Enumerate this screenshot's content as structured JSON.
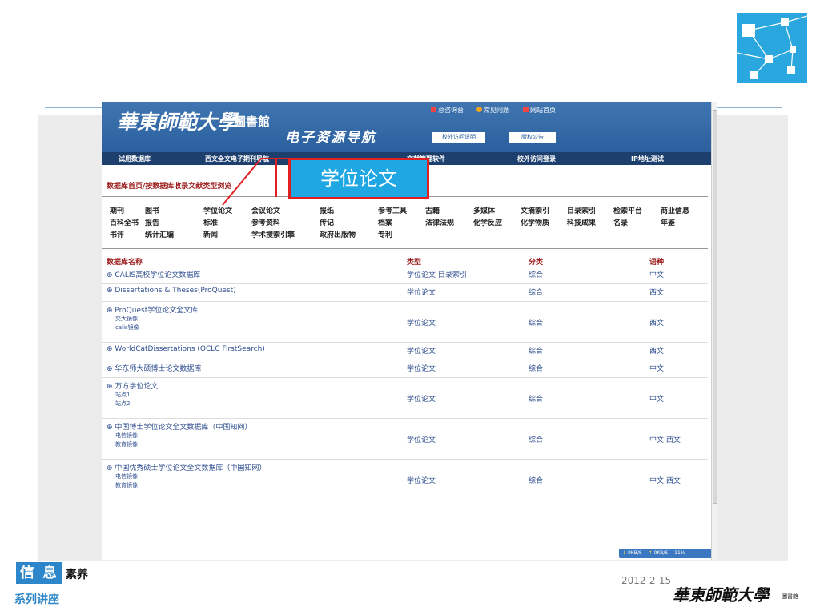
{
  "slide": {
    "callout": "学位论文",
    "badge": "信 息",
    "badge_suffix": "素养",
    "series": "系列讲座",
    "date": "2012-2-15",
    "footer_logo": "華東師範大學",
    "footer_logo_small": "圖書館",
    "accent": "#2c86c9"
  },
  "site": {
    "logo": "華東師範大學",
    "logo_small": "圖書館",
    "slogan": "电子资源导航",
    "top_links": [
      "总咨询台",
      "常见问题",
      "网站首页"
    ],
    "top_buttons": [
      "校外访问说明",
      "版权公告"
    ],
    "nav": [
      "试用数据库",
      "西文全文电子期刊导航",
      "文献管理软件",
      "校外访问登录",
      "IP地址测试"
    ],
    "breadcrumb": "数据库首页/按数据库收录文献类型浏览",
    "categories": [
      [
        "期刊",
        "百科全书",
        "书评"
      ],
      [
        "图书",
        "报告",
        "统计汇编"
      ],
      [
        "学位论文",
        "标准",
        "新闻"
      ],
      [
        "会议论文",
        "参考资料",
        "学术搜索引擎"
      ],
      [
        "报纸",
        "传记",
        "政府出版物"
      ],
      [
        "参考工具",
        "档案",
        "专利"
      ],
      [
        "古籍",
        "法律法规"
      ],
      [
        "多媒体",
        "化学反应"
      ],
      [
        "文摘索引",
        "化学物质"
      ],
      [
        "目录索引",
        "科技成果"
      ],
      [
        "检索平台",
        "名录"
      ],
      [
        "商业信息",
        "年鉴"
      ]
    ],
    "headers": {
      "name": "数据库名称",
      "type": "类型",
      "class": "分类",
      "lang": "语种"
    },
    "rows": [
      {
        "name": "CALIS高校学位论文数据库",
        "subs": [],
        "type": "学位论文 目录索引",
        "class": "综合",
        "lang": "中文"
      },
      {
        "name": "Dissertations & Theses(ProQuest)",
        "subs": [],
        "type": "学位论文",
        "class": "综合",
        "lang": "西文"
      },
      {
        "name": "ProQuest学位论文全文库",
        "subs": [
          "交大镜像",
          "calis镜像"
        ],
        "type": "学位论文",
        "class": "综合",
        "lang": "西文"
      },
      {
        "name": "WorldCatDissertations (OCLC FirstSearch)",
        "subs": [],
        "type": "学位论文",
        "class": "综合",
        "lang": "西文"
      },
      {
        "name": "华东师大硕博士论文数据库",
        "subs": [],
        "type": "学位论文",
        "class": "综合",
        "lang": "中文"
      },
      {
        "name": "万方学位论文",
        "subs": [
          "站点1",
          "站点2"
        ],
        "type": "学位论文",
        "class": "综合",
        "lang": "中文"
      },
      {
        "name": "中国博士学位论文全文数据库（中国知网）",
        "subs": [
          "电信镜像",
          "教育镜像"
        ],
        "type": "学位论文",
        "class": "综合",
        "lang": "中文 西文"
      },
      {
        "name": "中国优秀硕士学位论文全文数据库（中国知网）",
        "subs": [
          "电信镜像",
          "教育镜像"
        ],
        "type": "学位论文",
        "class": "综合",
        "lang": "中文 西文"
      }
    ],
    "status": {
      "down": "0KB/S",
      "up": "0KB/S",
      "pct": "11%"
    }
  }
}
